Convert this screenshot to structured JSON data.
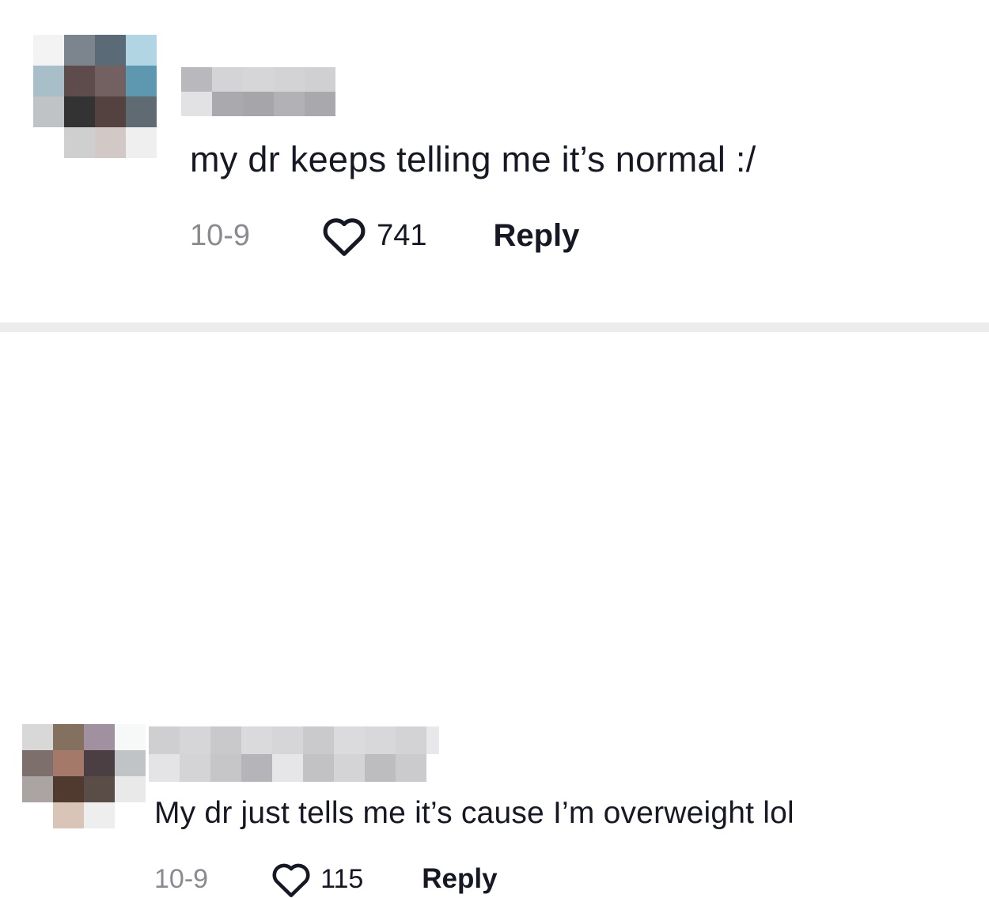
{
  "comments": [
    {
      "text": "my dr keeps telling me it’s normal :/",
      "date": "10-9",
      "likes": "741",
      "reply_label": "Reply",
      "avatar_colors": [
        "#f3f3f3",
        "#7c858d",
        "#5a6a76",
        "#b2d5e3",
        "#a8bec8",
        "#5e4b4b",
        "#726160",
        "#5e97b0",
        "#c0c3c6",
        "#343334",
        "#53423f",
        "#5f6a73",
        "#ffffff",
        "#cfcfcf",
        "#d2c9c7",
        "#efefef",
        "#ffffff",
        "#ffffff",
        "#ffffff",
        "#ffffff"
      ],
      "name_colors": [
        "#b9b9bd",
        "#d4d4d6",
        "#d6d6d8",
        "#d3d3d5",
        "#d0d0d2",
        "#e2e2e4",
        "#aaaaae",
        "#a6a6aa",
        "#b2b2b6",
        "#a9a9ad"
      ]
    },
    {
      "text": "My dr just tells me it’s cause I’m overweight lol",
      "date": "10-9",
      "likes": "115",
      "reply_label": "Reply",
      "avatar_colors": [
        "#d9d8d8",
        "#83705f",
        "#a090a0",
        "#f7f9f9",
        "#7d706c",
        "#a4796a",
        "#4b3f44",
        "#c1c4c6",
        "#aaa5a2",
        "#503a2f",
        "#5a4d48",
        "#e9e9e9",
        "#ffffff",
        "#d9c4b8",
        "#eeeeee",
        "#ffffff"
      ],
      "name_colors": [
        "#cfcfd1",
        "#d6d6d8",
        "#c9c9cc",
        "#dadadc",
        "#d6d6d8",
        "#cacacd",
        "#dbdbdd",
        "#d8d8da",
        "#d3d3d5",
        "#e8e8ea",
        "#e4e4e6",
        "#d4d4d6",
        "#c6c6c9",
        "#b5b5b9",
        "#e6e6e8",
        "#c2c2c5",
        "#d4d4d6",
        "#bdbdc0",
        "#cbcbcd",
        "#ffffff"
      ]
    }
  ],
  "colors": {
    "text": "#161823",
    "meta": "#8a8b91",
    "divider": "#ececec"
  },
  "icons": {
    "like": "heart-outline-icon"
  }
}
